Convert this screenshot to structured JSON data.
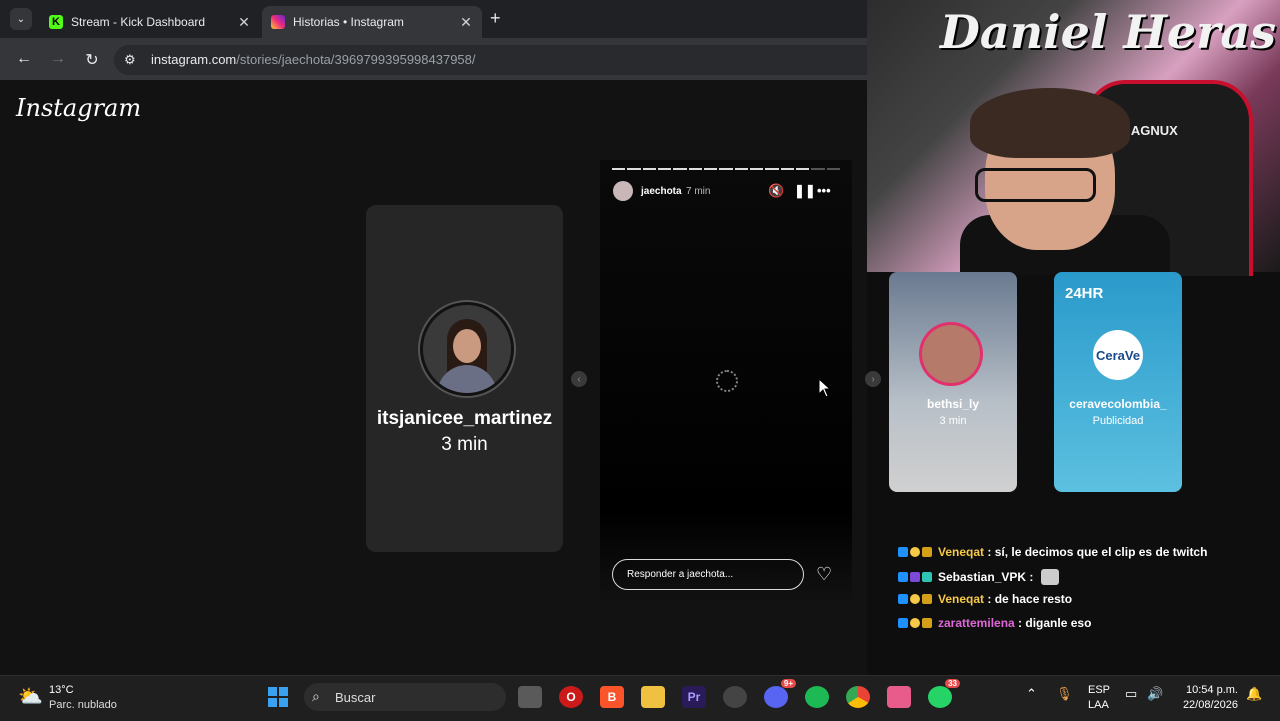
{
  "browser": {
    "tabs": [
      {
        "title": "Stream - Kick Dashboard",
        "favicon": "kick-icon",
        "active": false
      },
      {
        "title": "Historias • Instagram",
        "favicon": "instagram-icon",
        "active": true
      }
    ],
    "close_glyph": "✕",
    "new_tab_glyph": "+",
    "url_host": "instagram.com",
    "url_path": "/stories/jaechota/3969799395998437958/"
  },
  "instagram": {
    "logo": "Instagram",
    "previous_story": {
      "username": "itsjanicee_martinez",
      "time": "3 min"
    },
    "current_story": {
      "username": "jaechota",
      "time": "7 min",
      "reply_placeholder": "Responder a jaechota..."
    },
    "suggestions": [
      {
        "username": "bethsi_ly",
        "subtitle": "3 min"
      },
      {
        "username": "ceravecolombia_",
        "subtitle": "Publicidad",
        "brand": "CeraVe",
        "headline": "24HR"
      }
    ]
  },
  "webcam": {
    "wall_text": "Daniel Heras",
    "chair_brand": "MAGNUX"
  },
  "chat": [
    {
      "user": "Veneqat",
      "user_color": "#f7c948",
      "message": "sí, le decimos que el clip es de twitch"
    },
    {
      "user": "Sebastian_VPK",
      "user_color": "#ffffff",
      "message": "",
      "has_emote": true
    },
    {
      "user": "Veneqat",
      "user_color": "#f7c948",
      "message": "de hace resto"
    },
    {
      "user": "zarattemilena",
      "user_color": "#e066d8",
      "message": "diganle eso"
    }
  ],
  "taskbar": {
    "temperature": "13°C",
    "condition": "Parc. nublado",
    "search_label": "Buscar",
    "language": "ESP",
    "layout": "LAA",
    "time": "10:54 p.m.",
    "date": "22/08/2026",
    "discord_badge": "9+",
    "whatsapp_badge": "33"
  }
}
